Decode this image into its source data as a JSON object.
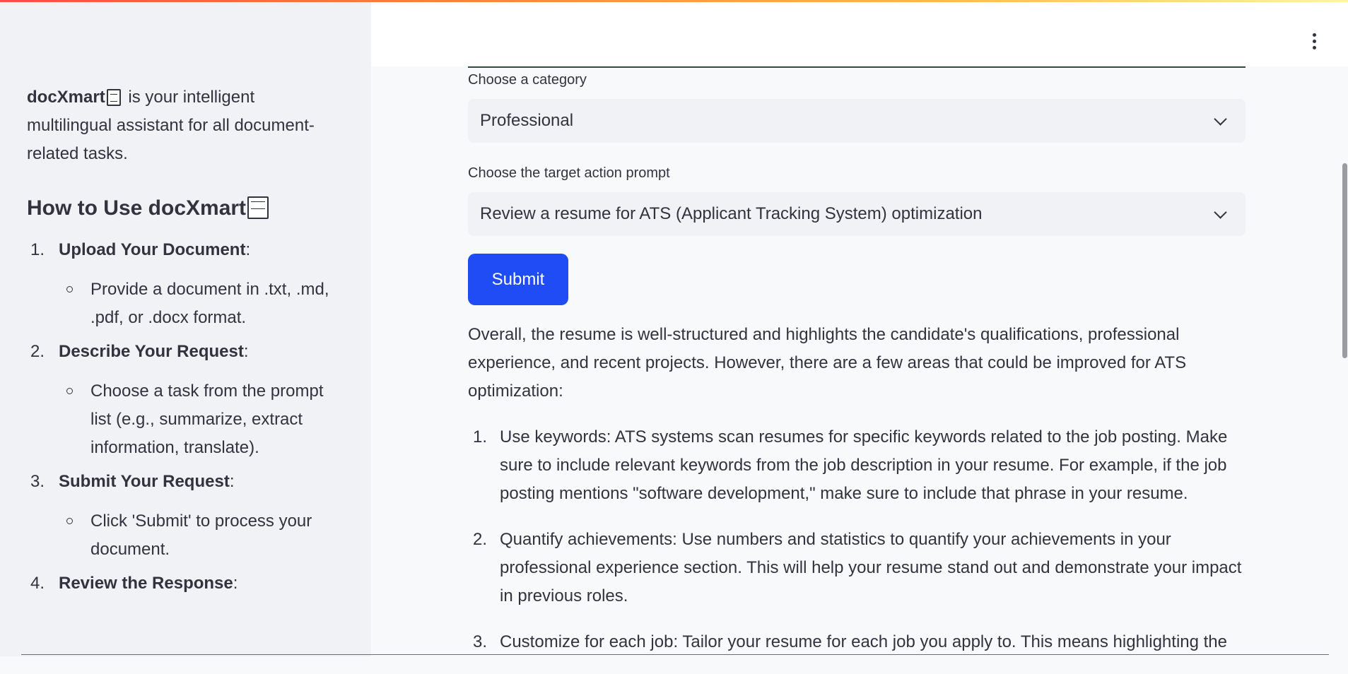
{
  "sidebar": {
    "intro_brand": "docXmart",
    "intro_rest": "is your intelligent multilingual assistant for all document-related tasks.",
    "heading": "How to Use docXmart",
    "steps": [
      {
        "num": "1.",
        "title": "Upload Your Document",
        "detail": "Provide a document in .txt, .md, .pdf, or .docx format."
      },
      {
        "num": "2.",
        "title": "Describe Your Request",
        "detail": "Choose a task from the prompt list (e.g., summarize, extract information, translate)."
      },
      {
        "num": "3.",
        "title": "Submit Your Request",
        "detail": "Click 'Submit' to process your document."
      },
      {
        "num": "4.",
        "title": "Review the Response",
        "detail": ""
      }
    ]
  },
  "main": {
    "category_label": "Choose a category",
    "category_value": "Professional",
    "prompt_label": "Choose the target action prompt",
    "prompt_value": "Review a resume for ATS (Applicant Tracking System) optimization",
    "submit_label": "Submit",
    "response_intro": "Overall, the resume is well-structured and highlights the candidate's qualifications, professional experience, and recent projects. However, there are a few areas that could be improved for ATS optimization:",
    "recommendations": [
      {
        "num": "1.",
        "text": "Use keywords: ATS systems scan resumes for specific keywords related to the job posting. Make sure to include relevant keywords from the job description in your resume. For example, if the job posting mentions \"software development,\" make sure to include that phrase in your resume."
      },
      {
        "num": "2.",
        "text": "Quantify achievements: Use numbers and statistics to quantify your achievements in your professional experience section. This will help your resume stand out and demonstrate your impact in previous roles."
      },
      {
        "num": "3.",
        "text": "Customize for each job: Tailor your resume for each job you apply to. This means highlighting the"
      }
    ]
  },
  "colors": {
    "accent": "#1f4cf5",
    "sidebar_bg": "#f0f2f6",
    "text": "#31333f"
  },
  "icons": {
    "brand": "document-icon",
    "menu": "kebab-menu-icon",
    "select": "chevron-down-icon"
  }
}
